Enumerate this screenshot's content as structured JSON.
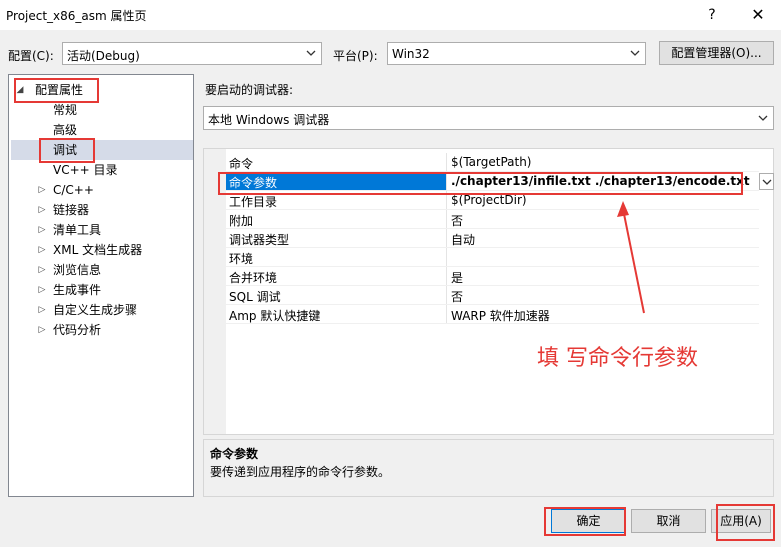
{
  "window": {
    "title": "Project_x86_asm 属性页",
    "help": "?",
    "close": "✕"
  },
  "config_bar": {
    "config_label": "配置(C):",
    "config_value": "活动(Debug)",
    "platform_label": "平台(P):",
    "platform_value": "Win32",
    "config_manager_button": "配置管理器(O)..."
  },
  "tree": {
    "root": "配置属性",
    "items": [
      {
        "label": "常规",
        "expander": ""
      },
      {
        "label": "高级",
        "expander": ""
      },
      {
        "label": "调试",
        "expander": "",
        "selected": true
      },
      {
        "label": "VC++ 目录",
        "expander": ""
      },
      {
        "label": "C/C++",
        "expander": "▷"
      },
      {
        "label": "链接器",
        "expander": "▷"
      },
      {
        "label": "清单工具",
        "expander": "▷"
      },
      {
        "label": "XML 文档生成器",
        "expander": "▷"
      },
      {
        "label": "浏览信息",
        "expander": "▷"
      },
      {
        "label": "生成事件",
        "expander": "▷"
      },
      {
        "label": "自定义生成步骤",
        "expander": "▷"
      },
      {
        "label": "代码分析",
        "expander": "▷"
      }
    ]
  },
  "debugger": {
    "label": "要启动的调试器:",
    "value": "本地 Windows 调试器"
  },
  "properties": [
    {
      "name": "命令",
      "value": "$(TargetPath)"
    },
    {
      "name": "命令参数",
      "value": "./chapter13/infile.txt ./chapter13/encode.txt",
      "selected": true
    },
    {
      "name": "工作目录",
      "value": "$(ProjectDir)"
    },
    {
      "name": "附加",
      "value": "否"
    },
    {
      "name": "调试器类型",
      "value": "自动"
    },
    {
      "name": "环境",
      "value": ""
    },
    {
      "name": "合并环境",
      "value": "是"
    },
    {
      "name": "SQL 调试",
      "value": "否"
    },
    {
      "name": "Amp 默认快捷键",
      "value": "WARP 软件加速器"
    }
  ],
  "description": {
    "title": "命令参数",
    "text": "要传递到应用程序的命令行参数。"
  },
  "buttons": {
    "ok": "确定",
    "cancel": "取消",
    "apply": "应用(A)"
  },
  "annotation": {
    "text": "填 写命令行参数",
    "color": "#e53935"
  },
  "colors": {
    "selection": "#0078d7",
    "tree_selection": "#d5dbe8",
    "accent_red": "#e53935"
  }
}
